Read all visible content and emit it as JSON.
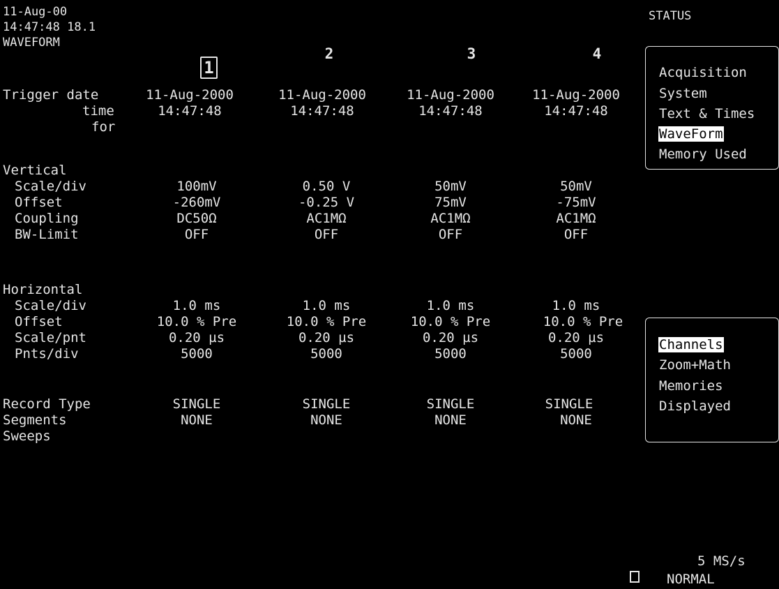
{
  "header": {
    "date": "11-Aug-00",
    "time": "14:47:48 18.1",
    "section": "WAVEFORM",
    "status_title": "STATUS"
  },
  "channels": [
    "1",
    "2",
    "3",
    "4"
  ],
  "selected_channel": "1",
  "labels": {
    "trigger_date": "Trigger date",
    "trigger_time": "time",
    "trigger_for": "for",
    "vertical": "Vertical",
    "v_scale": "Scale/div",
    "v_offset": "Offset",
    "v_coupling": "Coupling",
    "v_bw": "BW-Limit",
    "horizontal": "Horizontal",
    "h_scale": "Scale/div",
    "h_offset": "Offset",
    "h_scale_pnt": "Scale/pnt",
    "h_pnts": "Pnts/div",
    "record_type": "Record Type",
    "segments": "Segments",
    "sweeps": "Sweeps"
  },
  "values": {
    "trigger_date": [
      "11-Aug-2000",
      "11-Aug-2000",
      "11-Aug-2000",
      "11-Aug-2000"
    ],
    "trigger_time": [
      "14:47:48",
      "14:47:48",
      "14:47:48",
      "14:47:48"
    ],
    "v_scale": [
      "100mV",
      "0.50 V",
      "50mV",
      "50mV"
    ],
    "v_offset": [
      "-260mV",
      "-0.25 V",
      "75mV",
      "-75mV"
    ],
    "v_coupling": [
      "DC50Ω",
      "AC1MΩ",
      "AC1MΩ",
      "AC1MΩ"
    ],
    "v_bw": [
      "OFF",
      "OFF",
      "OFF",
      "OFF"
    ],
    "h_scale": [
      "1.0 ms",
      "1.0 ms",
      "1.0 ms",
      "1.0 ms"
    ],
    "h_offset": [
      "10.0 % Pre",
      "10.0 % Pre",
      "10.0 % Pre",
      "10.0 % Pre"
    ],
    "h_scale_pnt": [
      "0.20 µs",
      "0.20 µs",
      "0.20 µs",
      "0.20 µs"
    ],
    "h_pnts": [
      "5000",
      "5000",
      "5000",
      "5000"
    ],
    "record_type": [
      "SINGLE",
      "SINGLE",
      "SINGLE",
      "SINGLE"
    ],
    "segments": [
      "NONE",
      "NONE",
      "NONE",
      "NONE"
    ]
  },
  "status_menu": {
    "items": [
      "Acquisition",
      "System",
      "Text & Times",
      "WaveForm",
      "Memory Used"
    ],
    "active": "WaveForm"
  },
  "display_menu": {
    "items": [
      "Channels",
      "Zoom+Math",
      "Memories",
      "Displayed"
    ],
    "active": "Channels"
  },
  "footer": {
    "sample_rate": "5 MS/s",
    "trigger_mode": "NORMAL"
  }
}
